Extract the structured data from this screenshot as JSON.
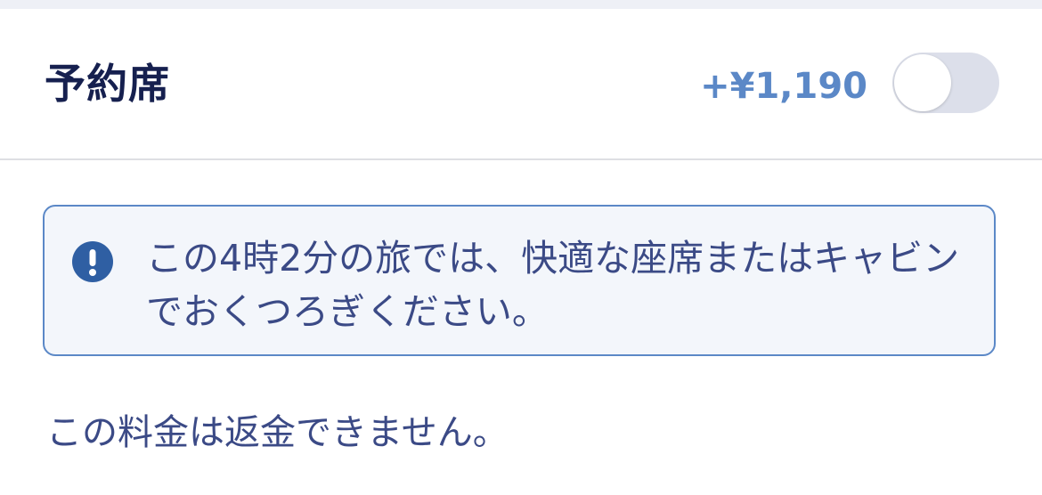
{
  "seat_option": {
    "title": "予約席",
    "price": "+¥1,190",
    "toggle_on": false
  },
  "info": {
    "icon": "exclamation-icon",
    "message": "この4時2分の旅では、快適な座席またはキャビンでおくつろぎください。"
  },
  "note": "この料金は返金できません。",
  "colors": {
    "title": "#16204f",
    "price": "#5b88c7",
    "info_border": "#5b88c7",
    "info_background": "#f3f6fb",
    "text": "#3b4a86",
    "icon": "#2f5fa3",
    "toggle_off": "#dcdfea"
  }
}
